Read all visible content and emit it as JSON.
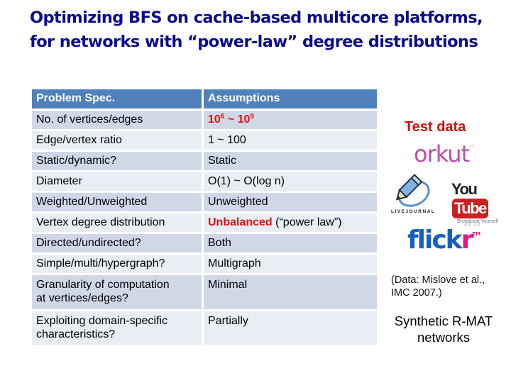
{
  "slide": {
    "title_lines": [
      "Optimizing BFS on cache-based multicore platforms,",
      "for  networks with “power-law” degree distributions"
    ]
  },
  "table": {
    "headers": [
      "Problem Spec.",
      "Assumptions"
    ],
    "rows": [
      {
        "spec": "No. of vertices/edges",
        "assumption_base1": "10",
        "assumption_exp1": "6",
        "assumption_sep": " ~ ",
        "assumption_base2": "10",
        "assumption_exp2": "9",
        "highlight": true
      },
      {
        "spec": "Edge/vertex ratio",
        "assumption": "1 ~ 100"
      },
      {
        "spec": "Static/dynamic?",
        "assumption": "Static"
      },
      {
        "spec": "Diameter",
        "assumption": "O(1) ~ O(log n)"
      },
      {
        "spec": "Weighted/Unweighted",
        "assumption": "Unweighted"
      },
      {
        "spec": "Vertex degree distribution",
        "assumption_highlight": "Unbalanced",
        "assumption_rest": " (“power law”)"
      },
      {
        "spec": "Directed/undirected?",
        "assumption": "Both"
      },
      {
        "spec": "Simple/multi/hypergraph?",
        "assumption": "Multigraph"
      },
      {
        "spec_line1": "Granularity of computation",
        "spec_line2": "at vertices/edges?",
        "assumption": "Minimal"
      },
      {
        "spec_line1": "Exploiting domain-specific",
        "spec_line2": "characteristics?",
        "assumption": "Partially"
      }
    ],
    "colors": {
      "header": "#4f81bd",
      "row_dark": "#d0d8e8",
      "row_light": "#e9edf4",
      "highlight": "#e01010"
    }
  },
  "sidebar": {
    "heading": "Test data",
    "logos": {
      "orkut": "orkut",
      "orkut_tm": "sm",
      "livejournal": "LIVEJOURNAL",
      "youtube_you": "You",
      "youtube_tube": "Tube",
      "youtube_tagline": "Broadcast Yourself",
      "flickr_main": "flick",
      "flickr_r": "r",
      "flickr_beta": "BETA",
      "flickr_tm": "TM"
    },
    "citation_line1": "(Data: Mislove et al.,",
    "citation_line2": "IMC 2007.)",
    "synthetic_line1": "Synthetic R-MAT",
    "synthetic_line2": "networks"
  }
}
